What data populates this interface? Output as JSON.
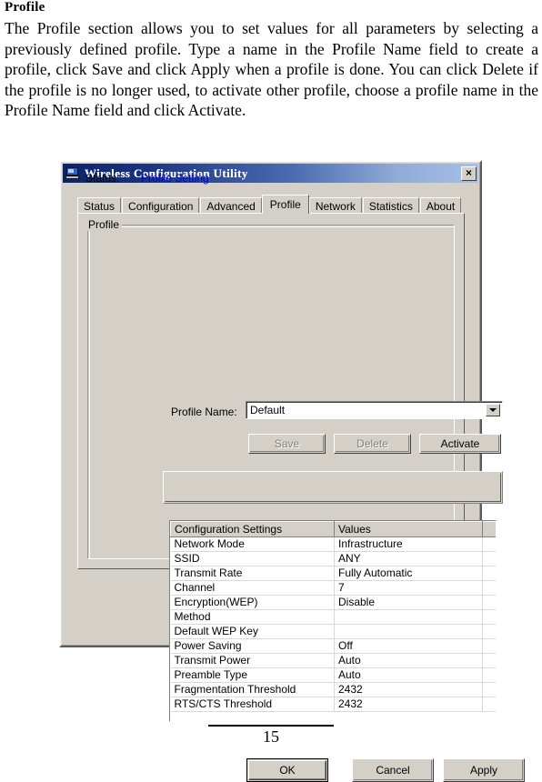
{
  "document": {
    "heading": "Profile",
    "paragraph": "The Profile section allows you to set values for all parameters by selecting a previously defined profile. Type a name in the Profile Name field to create a profile, click Save and click Apply when a profile is done. You can click Delete if the profile is no longer used, to activate other profile, choose a profile name in the Profile Name field and click Activate.",
    "page_number": "15"
  },
  "dialog": {
    "title": "Wireless Configuration Utility",
    "title_icon": "computer-icon",
    "close_label": "×",
    "close_icon": "close-icon",
    "tabs": [
      {
        "label": "Status",
        "active": false
      },
      {
        "label": "Configuration",
        "active": false
      },
      {
        "label": "Advanced",
        "active": false
      },
      {
        "label": "Profile",
        "active": true
      },
      {
        "label": "Network",
        "active": false
      },
      {
        "label": "Statistics",
        "active": false
      },
      {
        "label": "About",
        "active": false
      }
    ],
    "group": {
      "title": "Profile",
      "profile_name_label": "Profile Name:",
      "profile_name_value": "Default",
      "dropdown_icon": "chevron-down-icon",
      "buttons": [
        {
          "label": "Save",
          "enabled": false
        },
        {
          "label": "Delete",
          "enabled": false
        },
        {
          "label": "Activate",
          "enabled": true
        }
      ],
      "status": {
        "label": "Status:",
        "value": "Profile Setting",
        "value_color": "#0000d0"
      },
      "table": {
        "headers": [
          "Configuration Settings",
          "Values"
        ],
        "rows": [
          {
            "setting": "Network Mode",
            "value": "Infrastructure"
          },
          {
            "setting": "SSID",
            "value": "ANY"
          },
          {
            "setting": "Transmit Rate",
            "value": "Fully Automatic"
          },
          {
            "setting": "Channel",
            "value": "7"
          },
          {
            "setting": "Encryption(WEP)",
            "value": "Disable"
          },
          {
            "setting": "Method",
            "value": ""
          },
          {
            "setting": "Default WEP Key",
            "value": ""
          },
          {
            "setting": "Power Saving",
            "value": "Off"
          },
          {
            "setting": "Transmit Power",
            "value": "Auto"
          },
          {
            "setting": "Preamble Type",
            "value": "Auto"
          },
          {
            "setting": "Fragmentation Threshold",
            "value": "2432"
          },
          {
            "setting": "RTS/CTS Threshold",
            "value": "2432"
          }
        ]
      }
    },
    "footer_buttons": [
      {
        "label": "OK",
        "default": true
      },
      {
        "label": "Cancel",
        "default": false
      },
      {
        "label": "Apply",
        "default": false
      }
    ]
  },
  "colors": {
    "dialog_face": "#d4d0c8",
    "titlebar_start": "#0a246a",
    "titlebar_end": "#a6c0e8",
    "status_link": "#0000d0"
  }
}
